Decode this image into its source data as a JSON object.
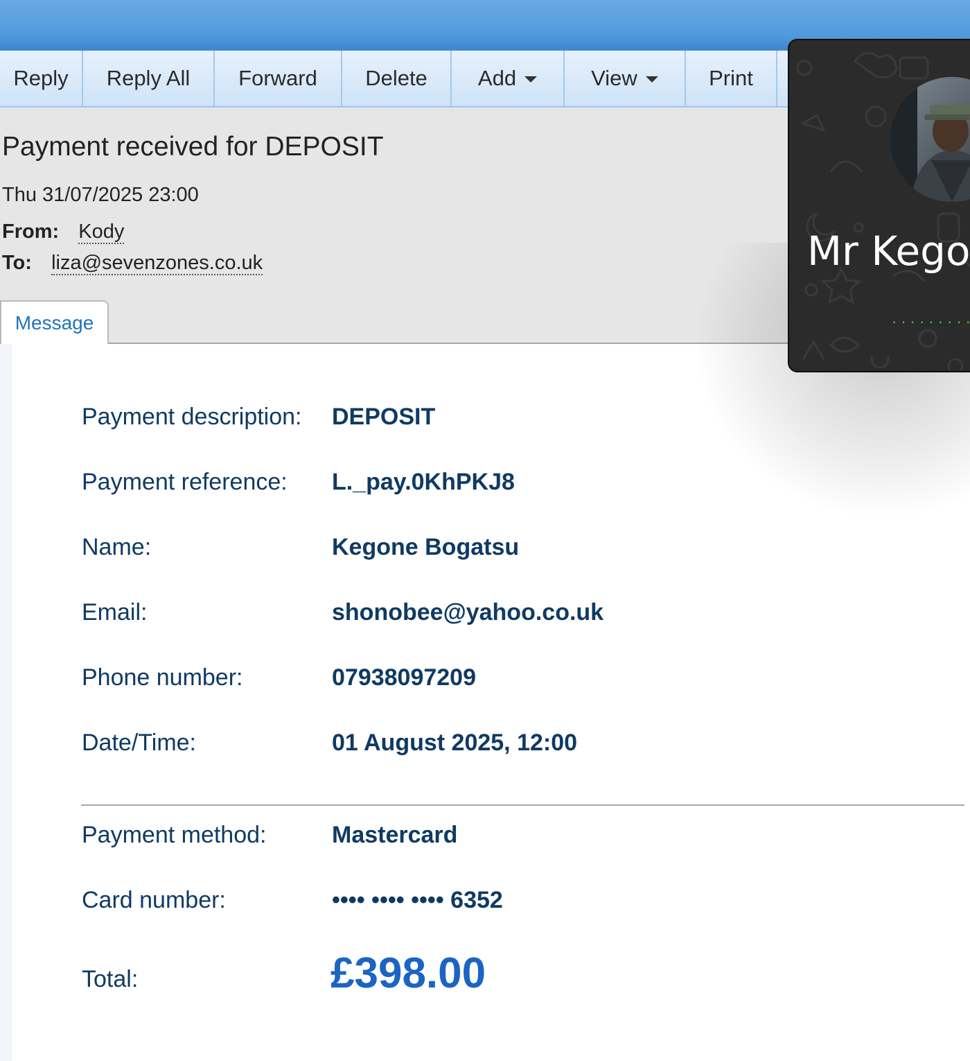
{
  "toolbar": {
    "buttons": [
      {
        "label": "Reply"
      },
      {
        "label": "Reply All"
      },
      {
        "label": "Forward"
      },
      {
        "label": "Delete"
      },
      {
        "label": "Add",
        "dropdown": true
      },
      {
        "label": "View",
        "dropdown": true
      },
      {
        "label": "Print"
      }
    ]
  },
  "email": {
    "subject": "Payment received for DEPOSIT",
    "date": "Thu 31/07/2025 23:00",
    "from_label": "From:",
    "from": "Kody",
    "to_label": "To:",
    "to": "liza@sevenzones.co.uk"
  },
  "tabs": {
    "message": "Message"
  },
  "payment": {
    "fields": [
      {
        "label": "Payment description:",
        "value": "DEPOSIT"
      },
      {
        "label": "Payment reference:",
        "value": "L._pay.0KhPKJ8"
      },
      {
        "label": "Name:",
        "value": "Kegone Bogatsu"
      },
      {
        "label": "Email:",
        "value": "shonobee@yahoo.co.uk"
      },
      {
        "label": "Phone number:",
        "value": "07938097209"
      },
      {
        "label": "Date/Time:",
        "value": "01 August 2025, 12:00"
      }
    ],
    "method_label": "Payment method:",
    "method": "Mastercard",
    "card_label": "Card number:",
    "card": "•••• •••• •••• 6352",
    "total_label": "Total:",
    "total": "£398.00"
  },
  "call": {
    "caller_name": "Mr Kegor",
    "status_dots": "············"
  },
  "colors": {
    "accent": "#1c64c4",
    "label_text": "#0f3a63",
    "title_bar": "#5199dc",
    "call_status": "#4fd25d"
  }
}
